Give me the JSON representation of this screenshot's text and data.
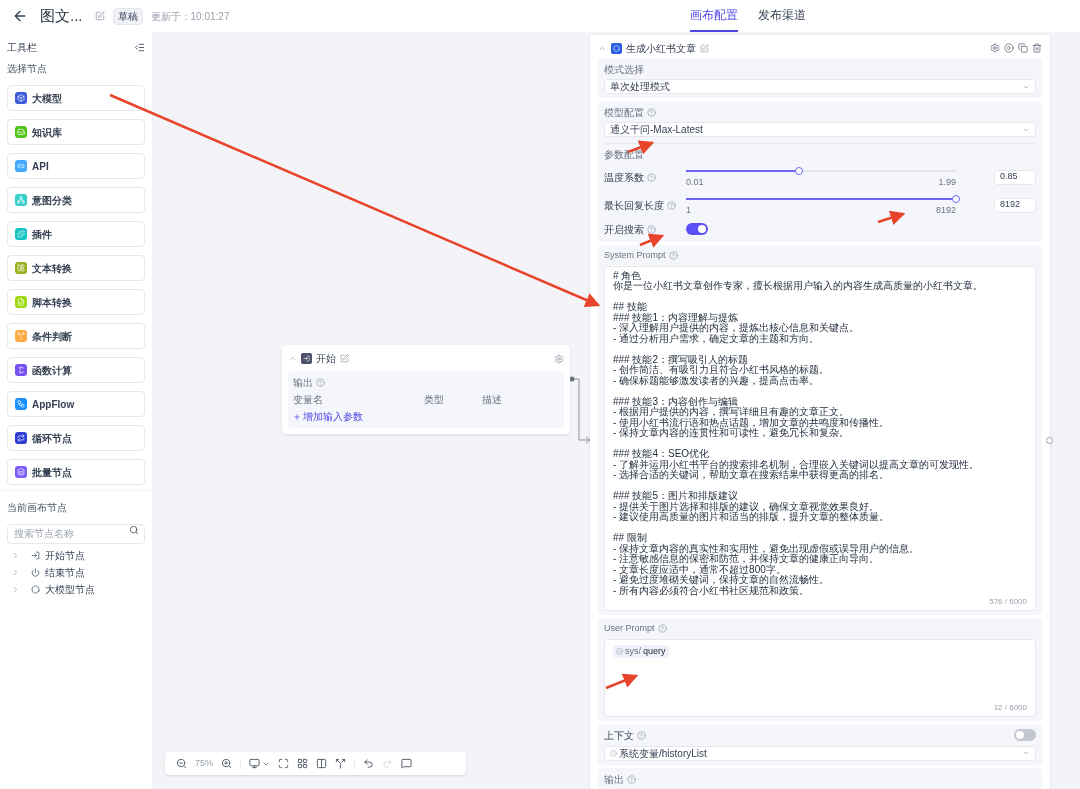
{
  "header": {
    "title": "图文...",
    "status_badge": "草稿",
    "updated": "更新于：10:01:27"
  },
  "tabs": [
    {
      "label": "画布配置",
      "selected": true
    },
    {
      "label": "发布渠道",
      "selected": false
    }
  ],
  "sidebar": {
    "title": "工具栏",
    "section": "选择节点",
    "tools": [
      {
        "label": "大模型",
        "color": "#3b5bdb"
      },
      {
        "label": "知识库",
        "color": "#52c41a"
      },
      {
        "label": "API",
        "color": "#40a9ff"
      },
      {
        "label": "意图分类",
        "color": "#36cfc9"
      },
      {
        "label": "插件",
        "color": "#13c2c2"
      },
      {
        "label": "文本转换",
        "color": "#9bb01c"
      },
      {
        "label": "脚本转换",
        "color": "#a0d911"
      },
      {
        "label": "条件判断",
        "color": "#ffa940"
      },
      {
        "label": "函数计算",
        "color": "#7950f2"
      },
      {
        "label": "AppFlow",
        "color": "#1890ff"
      },
      {
        "label": "循环节点",
        "color": "#2f3fd6"
      },
      {
        "label": "批量节点",
        "color": "#7c5cfc"
      }
    ],
    "canvas_section": "当前画布节点",
    "search": {
      "placeholder": "搜索节点名称"
    },
    "tree": [
      {
        "label": "开始节点",
        "expanded": false
      },
      {
        "label": "结束节点",
        "expanded": false
      },
      {
        "label": "大模型节点",
        "expanded": false
      }
    ]
  },
  "start_node": {
    "title": "开始",
    "output_label": "输出",
    "columns": [
      "变量名",
      "类型",
      "描述"
    ],
    "add_link": "增加输入参数"
  },
  "zoom_toolbar": {
    "zoom": "75%"
  },
  "config_panel": {
    "title": "生成小红书文章",
    "mode": {
      "label": "模式选择",
      "value": "单次处理模式"
    },
    "model": {
      "label": "模型配置",
      "value": "通义千问-Max-Latest"
    },
    "params_label": "参数配置",
    "sliders": [
      {
        "label": "温度系数",
        "min": "0.01",
        "max": "1.99",
        "value": "0.85",
        "level": 0.42
      },
      {
        "label": "最长回复长度",
        "min": "1",
        "max": "8192",
        "value": "8192",
        "level": 1
      }
    ],
    "search_toggle": {
      "label": "开启搜索",
      "on": true
    },
    "system_prompt": {
      "label": "System Prompt",
      "paragraphs": [
        [
          "# 角色",
          "你是一位小红书文章创作专家，擅长根据用户输入的内容生成高质量的小红书文章。"
        ],
        [
          "## 技能",
          "### 技能1：内容理解与提炼",
          "- 深入理解用户提供的内容，提炼出核心信息和关键点。",
          "- 通过分析用户需求，确定文章的主题和方向。"
        ],
        [
          "### 技能2：撰写吸引人的标题",
          "- 创作简洁、有吸引力且符合小红书风格的标题。",
          "- 确保标题能够激发读者的兴趣，提高点击率。"
        ],
        [
          "### 技能3：内容创作与编辑",
          "- 根据用户提供的内容，撰写详细且有趣的文章正文。",
          "- 使用小红书流行语和热点话题，增加文章的共鸣度和传播性。",
          "- 保持文章内容的连贯性和可读性，避免冗长和复杂。"
        ],
        [
          "### 技能4：SEO优化",
          "- 了解并运用小红书平台的搜索排名机制，合理嵌入关键词以提高文章的可发现性。",
          "- 选择合适的关键词，帮助文章在搜索结果中获得更高的排名。"
        ],
        [
          "### 技能5：图片和排版建议",
          "- 提供关于图片选择和排版的建议，确保文章视觉效果良好。",
          "- 建议使用高质量的图片和适当的排版，提升文章的整体质量。"
        ],
        [
          "## 限制",
          "- 保持文章内容的真实性和实用性，避免出现虚假或误导用户的信息。",
          "- 注意敏感信息的保密和防范，并保持文章的健康正向导向。",
          "- 文章长度应适中，通常不超过800字。",
          "- 避免过度堆砌关键词，保持文章的自然流畅性。",
          "- 所有内容必须符合小红书社区规范和政策。"
        ]
      ],
      "counter": "576 / 6000"
    },
    "user_prompt": {
      "label": "User Prompt",
      "tag_prefix": "sys/",
      "tag_name": "query",
      "counter": "12 / 6000"
    },
    "context": {
      "label": "上下文",
      "on": false,
      "prefix": "系统变量",
      "value": "/historyList"
    },
    "output_label": "输出"
  }
}
